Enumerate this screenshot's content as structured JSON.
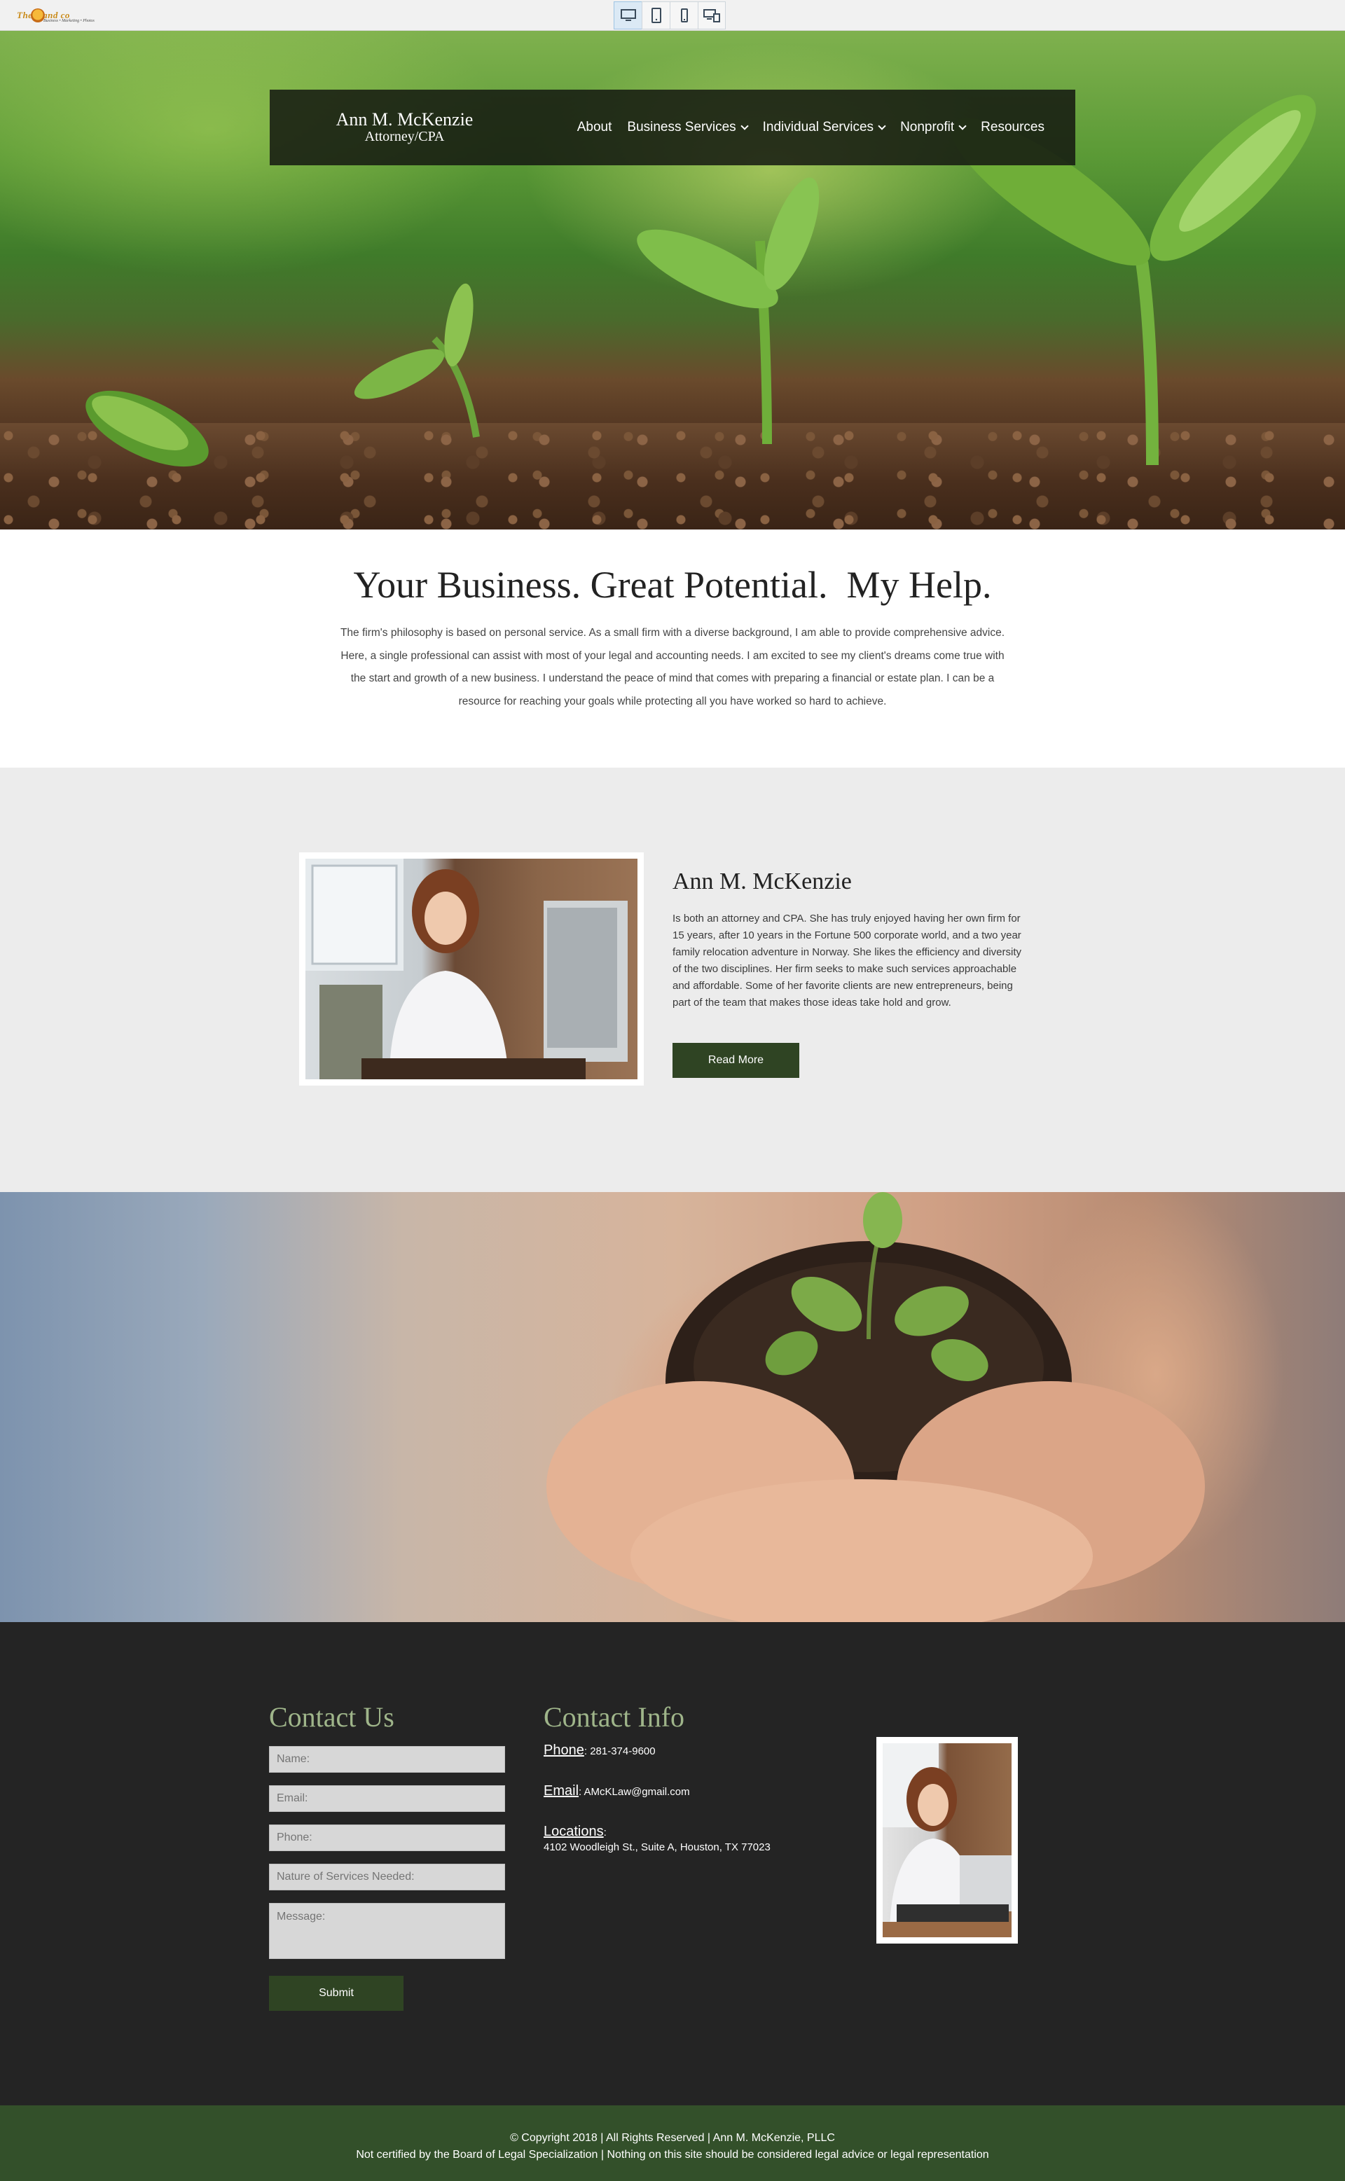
{
  "preview": {
    "logo_text": "TheBrand co",
    "logo_tagline": "Business • Marketing • Photos",
    "devices": [
      {
        "name": "desktop",
        "icon": "desktop-icon",
        "active": true
      },
      {
        "name": "tablet",
        "icon": "tablet-icon",
        "active": false
      },
      {
        "name": "mobile",
        "icon": "mobile-icon",
        "active": false
      },
      {
        "name": "all-devices",
        "icon": "multi-device-icon",
        "active": false
      }
    ]
  },
  "nav": {
    "brand_name": "Ann M. McKenzie",
    "brand_title": "Attorney/CPA",
    "items": [
      {
        "label": "About",
        "dropdown": false
      },
      {
        "label": "Business Services",
        "dropdown": true
      },
      {
        "label": "Individual Services",
        "dropdown": true
      },
      {
        "label": "Nonprofit",
        "dropdown": true
      },
      {
        "label": "Resources",
        "dropdown": false
      }
    ]
  },
  "intro": {
    "heading": "Your Business. Great Potential.  My Help.",
    "body": "The firm's philosophy is based on personal service. As a small firm with a diverse background, I am able to provide comprehensive advice. Here, a single professional can assist with most of your legal and accounting needs. I am excited to see my client's dreams come true with the start and growth of a new business. I understand the peace of mind that comes with preparing a financial or estate plan. I can be a resource for reaching your goals while protecting all you have worked so hard to achieve."
  },
  "about": {
    "name": "Ann M. McKenzie",
    "bio": "Is both an attorney and CPA. She has truly enjoyed having her own firm for 15 years, after 10 years in the Fortune 500 corporate world, and a two year family relocation adventure in Norway. She likes the efficiency and diversity of the two disciplines. Her firm seeks to make such services approachable and affordable. Some of her favorite clients are new entrepreneurs, being part of the team that makes those ideas take hold and grow.",
    "button": "Read More"
  },
  "contact": {
    "title": "Contact Us",
    "placeholders": {
      "name": "Name:",
      "email": "Email:",
      "phone": "Phone:",
      "services": "Nature of Services Needed:",
      "message": "Message:"
    },
    "submit": "Submit",
    "info_title": "Contact Info",
    "phone_label": "Phone",
    "phone": "281-374-9600",
    "email_label": "Email",
    "email": "AMcKLaw@gmail.com",
    "locations_label": "Locations",
    "address": "4102 Woodleigh St., Suite A, Houston, TX 77023"
  },
  "footer": {
    "line1": "© Copyright 2018  |  All Rights Reserved  |  Ann M. McKenzie, PLLC",
    "line2": "Not certified by the Board of Legal Specialization  |  Nothing on this site should be considered legal advice or legal representation"
  },
  "colors": {
    "accent_green": "#2f4423",
    "footer_green": "#33502a",
    "heading_green": "#9fb58a",
    "dark_bg": "#242424",
    "light_bg": "#ececec"
  }
}
